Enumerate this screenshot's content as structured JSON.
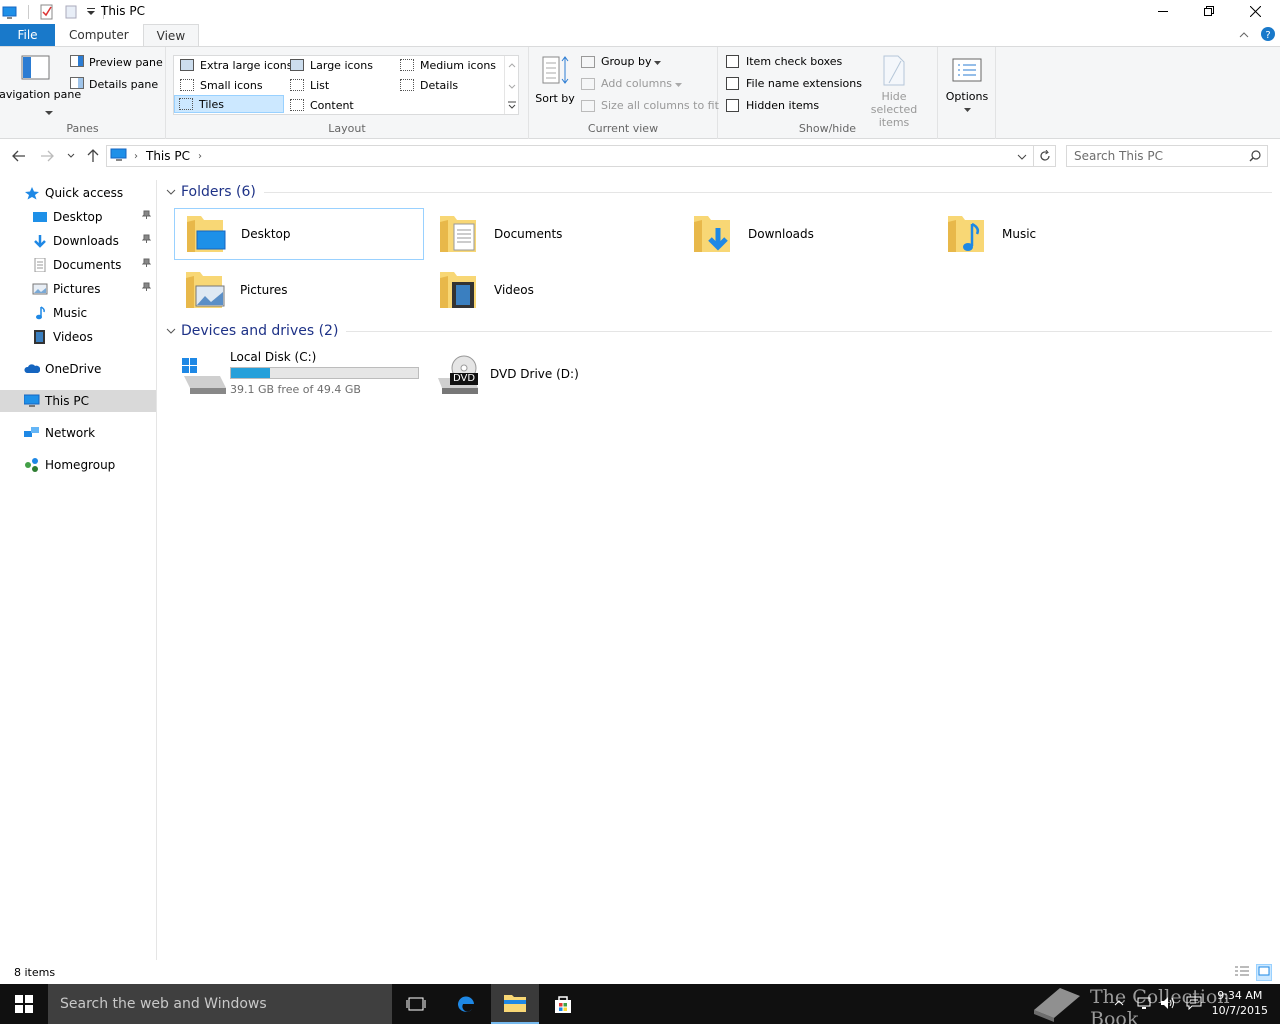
{
  "window": {
    "title": "This PC"
  },
  "ribbon": {
    "tabs": [
      "File",
      "Computer",
      "View"
    ],
    "panes": {
      "label": "Panes",
      "navigation_pane": "Navigation pane",
      "preview_pane": "Preview pane",
      "details_pane": "Details pane"
    },
    "layout": {
      "label": "Layout",
      "options": [
        "Extra large icons",
        "Large icons",
        "Medium icons",
        "Small icons",
        "List",
        "Details",
        "Tiles",
        "Content"
      ],
      "selected": "Tiles"
    },
    "current_view": {
      "label": "Current view",
      "sort_by": "Sort by",
      "group_by": "Group by",
      "add_columns": "Add columns",
      "size_all_columns": "Size all columns to fit"
    },
    "show_hide": {
      "label": "Show/hide",
      "item_check_boxes": "Item check boxes",
      "file_name_extensions": "File name extensions",
      "hidden_items": "Hidden items",
      "hide_selected_items": "Hide selected items"
    },
    "options": "Options"
  },
  "address": {
    "location": "This PC",
    "search_placeholder": "Search This PC"
  },
  "sidebar": {
    "items": [
      {
        "label": "Quick access",
        "icon": "star-icon"
      },
      {
        "label": "Desktop",
        "icon": "desktop-icon",
        "pinned": true
      },
      {
        "label": "Downloads",
        "icon": "download-icon",
        "pinned": true
      },
      {
        "label": "Documents",
        "icon": "document-icon",
        "pinned": true
      },
      {
        "label": "Pictures",
        "icon": "picture-icon",
        "pinned": true
      },
      {
        "label": "Music",
        "icon": "music-icon"
      },
      {
        "label": "Videos",
        "icon": "video-icon"
      },
      {
        "label": "OneDrive",
        "icon": "cloud-icon"
      },
      {
        "label": "This PC",
        "icon": "computer-icon",
        "selected": true
      },
      {
        "label": "Network",
        "icon": "network-icon"
      },
      {
        "label": "Homegroup",
        "icon": "homegroup-icon"
      }
    ]
  },
  "folders": {
    "heading": "Folders (6)",
    "items": [
      {
        "label": "Desktop",
        "selected": true
      },
      {
        "label": "Documents"
      },
      {
        "label": "Downloads"
      },
      {
        "label": "Music"
      },
      {
        "label": "Pictures"
      },
      {
        "label": "Videos"
      }
    ]
  },
  "drives": {
    "heading": "Devices and drives (2)",
    "items": [
      {
        "label": "Local Disk (C:)",
        "free_text": "39.1 GB free of 49.4 GB",
        "used_fraction": 0.21
      },
      {
        "label": "DVD Drive (D:)",
        "badge": "DVD"
      }
    ]
  },
  "status": {
    "item_count": "8 items"
  },
  "taskbar": {
    "search_placeholder": "Search the web and Windows",
    "time": "9:34 AM",
    "date": "10/7/2015",
    "watermark": "The Collection Book"
  },
  "colors": {
    "accent": "#1979ca",
    "selection": "#cce8ff",
    "folder": "#f8d775",
    "drive_bar": "#26a0da"
  }
}
